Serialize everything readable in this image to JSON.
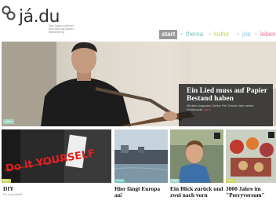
{
  "brand": {
    "name": "já.du",
    "tagline": "Das Jugend-Internet-Serviceportal Baden-Württemberg"
  },
  "nav": {
    "items": [
      {
        "label": "start",
        "color": "#ffffff"
      },
      {
        "label": "thema",
        "color": "#74c6c0"
      },
      {
        "label": "kultur",
        "color": "#c7d25b"
      },
      {
        "label": "job",
        "color": "#8fc7e8"
      },
      {
        "label": "leben",
        "color": "#e96f8d"
      }
    ],
    "separator": "•"
  },
  "hero": {
    "title": "Ein Lied muss auf Papier Bestand haben",
    "text": "Mit dem singenden Dichter Petr Čechek über seinen Debütroman.",
    "more": "Mehr",
    "tag": "Leben",
    "tag_color": "#9fd4c0"
  },
  "tiles": [
    {
      "title": "DIY",
      "subtitle": "Do it yourself!",
      "tag": "kultur",
      "tag_color": "#c7d25b",
      "graffiti": "Do it YOURSELF"
    },
    {
      "title": "Hier fängt Europa an!",
      "subtitle": "",
      "tag": "thema",
      "tag_color": "#74c6c0"
    },
    {
      "title": "Ein Blick zurück und zwei nach vorn",
      "subtitle": "",
      "tag": "leben",
      "tag_color": "#9fd4c0"
    },
    {
      "title": "3000 Jahre im \"Perryversum\"",
      "subtitle": "",
      "tag": "kultur",
      "tag_color": "#c7d25b"
    }
  ]
}
